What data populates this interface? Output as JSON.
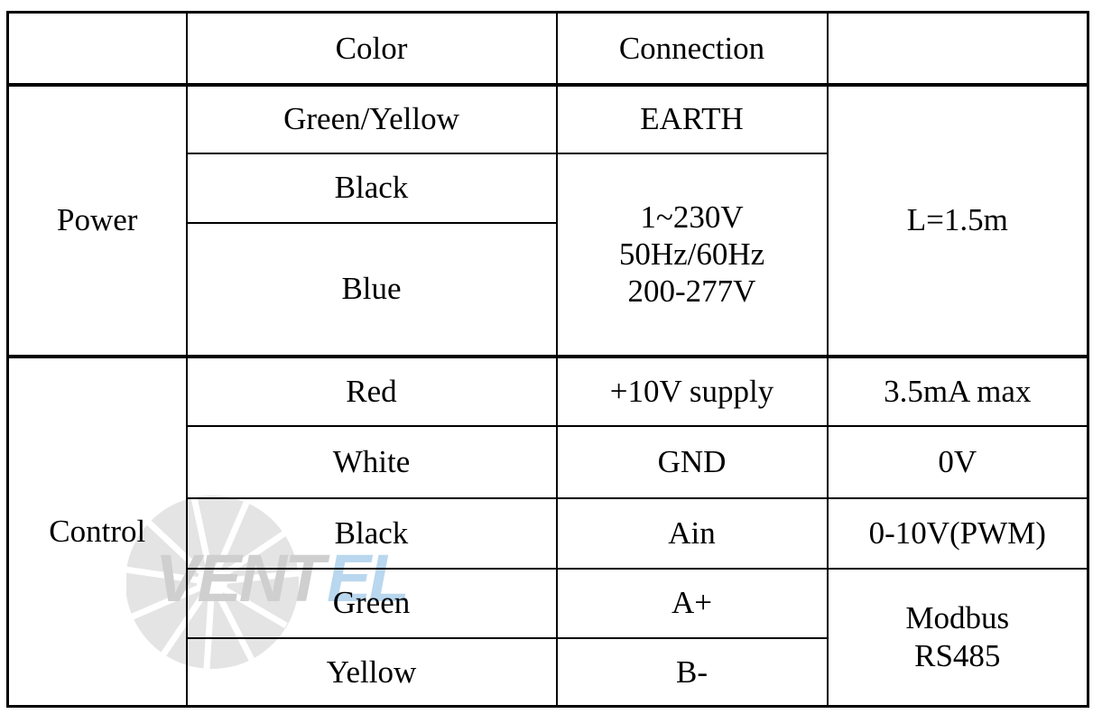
{
  "document": {
    "type": "wiring-specification-table",
    "watermark": {
      "text_primary": "VENT",
      "text_secondary": "EL",
      "primary_color": "#cfcfcf",
      "secondary_color": "#b9d7ee",
      "fan_color": "#e2e2e2"
    }
  },
  "table": {
    "header": {
      "category": "",
      "color": "Color",
      "connection": "Connection",
      "spec": ""
    },
    "sections": [
      {
        "name": "Power",
        "label": "Power",
        "rows": [
          {
            "color": "Green/Yellow",
            "connection": "EARTH",
            "spec": ""
          },
          {
            "color": "Black",
            "connection": "",
            "spec": ""
          },
          {
            "color": "Blue",
            "connection": "",
            "spec": ""
          }
        ],
        "merged_connection": {
          "line1": "1~230V",
          "line2": "50Hz/60Hz",
          "line3": "200-277V"
        },
        "merged_spec": "L=1.5m"
      },
      {
        "name": "Control",
        "label": "Control",
        "rows": [
          {
            "color": "Red",
            "connection": "+10V supply",
            "spec": "3.5mA max"
          },
          {
            "color": "White",
            "connection": "GND",
            "spec": "0V"
          },
          {
            "color": "Black",
            "connection": "Ain",
            "spec": "0-10V(PWM)"
          },
          {
            "color": "Green",
            "connection": "A+",
            "spec": ""
          },
          {
            "color": "Yellow",
            "connection": "B-",
            "spec": ""
          }
        ],
        "merged_spec": {
          "line1": "Modbus",
          "line2": "RS485"
        }
      }
    ]
  }
}
